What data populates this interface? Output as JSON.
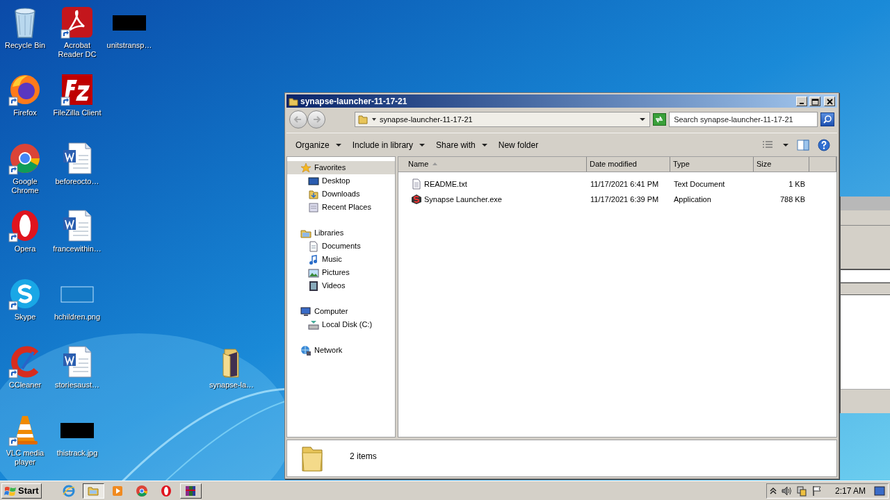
{
  "desktop": {
    "icons": [
      {
        "label": "Recycle Bin",
        "kind": "recycle",
        "shortcut": false
      },
      {
        "label": "Acrobat Reader DC",
        "kind": "pdf",
        "shortcut": true
      },
      {
        "label": "unitstransp…",
        "kind": "thumb-dark",
        "shortcut": false
      },
      {
        "label": "Firefox",
        "kind": "firefox",
        "shortcut": true
      },
      {
        "label": "FileZilla Client",
        "kind": "filezilla",
        "shortcut": true
      },
      {
        "label": "Google Chrome",
        "kind": "chrome",
        "shortcut": true
      },
      {
        "label": "beforeocto…",
        "kind": "word",
        "shortcut": false
      },
      {
        "label": "Opera",
        "kind": "opera",
        "shortcut": true
      },
      {
        "label": "francewithin…",
        "kind": "word",
        "shortcut": false
      },
      {
        "label": "Skype",
        "kind": "skype",
        "shortcut": true
      },
      {
        "label": "hchildren.png",
        "kind": "thumb-blank",
        "shortcut": false
      },
      {
        "label": "CCleaner",
        "kind": "ccleaner",
        "shortcut": true
      },
      {
        "label": "storiesaust…",
        "kind": "word",
        "shortcut": false
      },
      {
        "label": "synapse-la…",
        "kind": "folder",
        "shortcut": false
      },
      {
        "label": "VLC media player",
        "kind": "vlc",
        "shortcut": true
      },
      {
        "label": "thistrack.jpg",
        "kind": "thumb-dark",
        "shortcut": false
      }
    ]
  },
  "explorer": {
    "title": "synapse-launcher-11-17-21",
    "address": {
      "path": "synapse-launcher-11-17-21"
    },
    "search": {
      "placeholder": "Search synapse-launcher-11-17-21"
    },
    "toolbar": [
      {
        "label": "Organize",
        "menu": true
      },
      {
        "label": "Include in library",
        "menu": true
      },
      {
        "label": "Share with",
        "menu": true
      },
      {
        "label": "New folder",
        "menu": false
      }
    ],
    "nav": [
      {
        "label": "Favorites",
        "kind": "star",
        "selected": true,
        "children": [
          {
            "label": "Desktop",
            "kind": "desktop",
            "selected": false
          },
          {
            "label": "Downloads",
            "kind": "downloads",
            "selected": false
          },
          {
            "label": "Recent Places",
            "kind": "recent",
            "selected": false
          }
        ]
      },
      {
        "label": "Libraries",
        "kind": "library",
        "selected": false,
        "children": [
          {
            "label": "Documents",
            "kind": "documents",
            "selected": false
          },
          {
            "label": "Music",
            "kind": "music",
            "selected": false
          },
          {
            "label": "Pictures",
            "kind": "pictures",
            "selected": false
          },
          {
            "label": "Videos",
            "kind": "videos",
            "selected": false
          }
        ]
      },
      {
        "label": "Computer",
        "kind": "computer",
        "selected": false,
        "children": [
          {
            "label": "Local Disk (C:)",
            "kind": "disk",
            "selected": false
          }
        ]
      },
      {
        "label": "Network",
        "kind": "network",
        "selected": false
      }
    ],
    "columns": [
      {
        "label": "Name",
        "sorted": true
      },
      {
        "label": "Date modified",
        "sorted": false
      },
      {
        "label": "Type",
        "sorted": false
      },
      {
        "label": "Size",
        "sorted": false
      }
    ],
    "files": [
      {
        "name": "README.txt",
        "kind": "text",
        "date": "11/17/2021 6:41 PM",
        "type": "Text Document",
        "size": "1 KB"
      },
      {
        "name": "Synapse Launcher.exe",
        "kind": "app",
        "date": "11/17/2021 6:39 PM",
        "type": "Application",
        "size": "788 KB"
      }
    ],
    "details": {
      "count": "2 items"
    }
  },
  "taskbar": {
    "start": "Start",
    "buttons": [
      {
        "kind": "ie",
        "selected": false
      },
      {
        "kind": "explorer",
        "selected": true
      },
      {
        "kind": "media",
        "selected": false
      },
      {
        "kind": "chrome",
        "selected": false
      },
      {
        "kind": "opera",
        "selected": false
      },
      {
        "kind": "winrar",
        "selected": false
      }
    ],
    "clock": "2:17 AM"
  }
}
